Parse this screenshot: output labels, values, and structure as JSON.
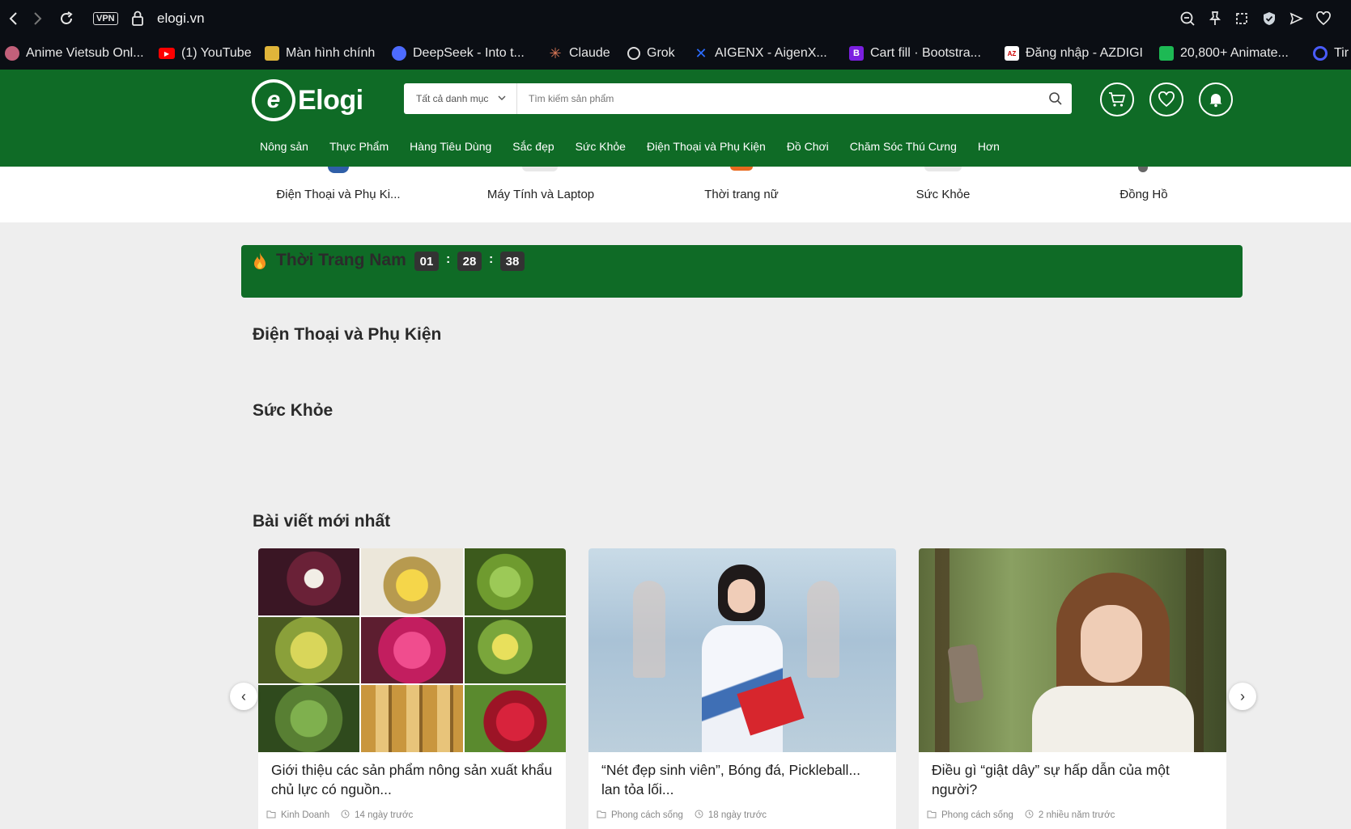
{
  "browser": {
    "url": "elogi.vn",
    "vpn_label": "VPN",
    "bookmarks": [
      {
        "label": "Anime Vietsub Onl...",
        "color": "#c2607a"
      },
      {
        "label": "(1) YouTube",
        "color": "#ff0000"
      },
      {
        "label": "Màn hình chính",
        "color": "#e0b53a"
      },
      {
        "label": "DeepSeek - Into t...",
        "color": "#4d6bfe"
      },
      {
        "label": "Claude",
        "color": "#d97757"
      },
      {
        "label": "Grok",
        "color": "#ffffff"
      },
      {
        "label": "AIGENX - AigenX...",
        "color": "#2b6cff"
      },
      {
        "label": "Cart fill · Bootstra...",
        "color": "#7b1fe0"
      },
      {
        "label": "Đăng nhập - AZDIGI",
        "color": "#ffffff"
      },
      {
        "label": "20,800+ Animate...",
        "color": "#1db954"
      },
      {
        "label": "Tir",
        "color": "#4a5cff"
      }
    ]
  },
  "header": {
    "logo_text": "Elogi",
    "logo_letter": "e",
    "category_select": "Tất cả danh mục",
    "search_placeholder": "Tìm kiếm sản phẩm",
    "brand_color": "#0f6b26"
  },
  "nav": [
    "Nông sản",
    "Thực Phẩm",
    "Hàng Tiêu Dùng",
    "Sắc đẹp",
    "Sức Khỏe",
    "Điện Thoại và Phụ Kiện",
    "Đồ Chơi",
    "Chăm Sóc Thú Cưng",
    "Hơn"
  ],
  "categories": [
    "Điện Thoại và Phụ Ki...",
    "Máy Tính và Laptop",
    "Thời trang nữ",
    "Sức Khỏe",
    "Đồng Hồ"
  ],
  "flash_sale": {
    "title": "Thời Trang Nam",
    "hours": "01",
    "minutes": "28",
    "seconds": "38",
    "separator": ":"
  },
  "sections": {
    "phones": "Điện Thoại và Phụ Kiện",
    "health": "Sức Khỏe",
    "blog": "Bài viết mới nhất"
  },
  "posts": [
    {
      "title": "Giới thiệu các sản phẩm nông sản xuất khẩu chủ lực có nguồn...",
      "category": "Kinh Doanh",
      "time": "14 ngày trước"
    },
    {
      "title": "“Nét đẹp sinh viên”, Bóng đá, Pickleball... lan tỏa lối...",
      "category": "Phong cách sống",
      "time": "18 ngày trước"
    },
    {
      "title": "Điều gì “giật dây” sự hấp dẫn của một người?",
      "category": "Phong cách sống",
      "time": "2 nhiều năm trước"
    }
  ],
  "carousel": {
    "prev": "‹",
    "next": "›"
  }
}
